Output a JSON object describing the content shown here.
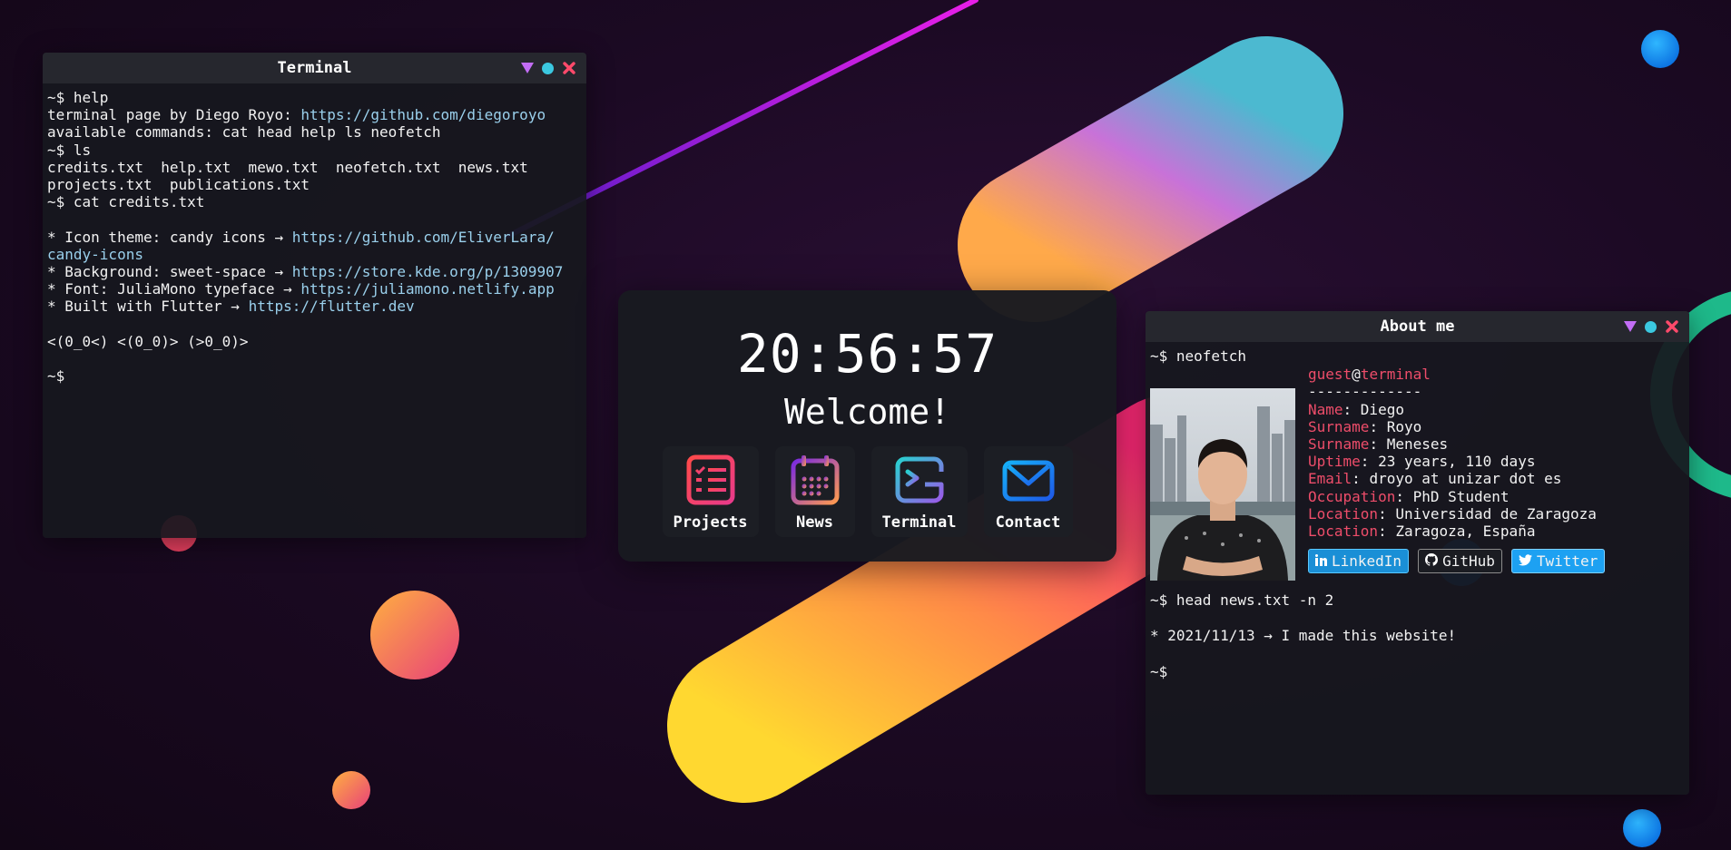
{
  "terminal": {
    "title": "Terminal",
    "lines": [
      [
        {
          "t": "~$ help"
        }
      ],
      [
        {
          "t": "terminal page by Diego Royo: "
        },
        {
          "t": "https://github.com/diegoroyo",
          "c": "link"
        }
      ],
      [
        {
          "t": "available commands: cat head help ls neofetch"
        }
      ],
      [
        {
          "t": "~$ ls"
        }
      ],
      [
        {
          "t": "credits.txt  help.txt  mewo.txt  neofetch.txt  news.txt"
        }
      ],
      [
        {
          "t": "projects.txt  publications.txt"
        }
      ],
      [
        {
          "t": "~$ cat credits.txt"
        }
      ],
      [
        {
          "t": ""
        }
      ],
      [
        {
          "t": "* Icon theme: candy icons → "
        },
        {
          "t": "https://github.com/EliverLara/",
          "c": "link"
        }
      ],
      [
        {
          "t": "candy-icons",
          "c": "link"
        }
      ],
      [
        {
          "t": "* Background: sweet-space → "
        },
        {
          "t": "https://store.kde.org/p/1309907",
          "c": "link"
        }
      ],
      [
        {
          "t": "* Font: JuliaMono typeface → "
        },
        {
          "t": "https://juliamono.netlify.app",
          "c": "link"
        }
      ],
      [
        {
          "t": "* Built with Flutter → "
        },
        {
          "t": "https://flutter.dev",
          "c": "link"
        }
      ],
      [
        {
          "t": ""
        }
      ],
      [
        {
          "t": "<(0_0<) <(0_0)> (>0_0)>"
        }
      ],
      [
        {
          "t": ""
        }
      ],
      [
        {
          "t": "~$"
        }
      ]
    ]
  },
  "launcher": {
    "clock": "20:56:57",
    "welcome": "Welcome!",
    "apps": [
      {
        "label": "Projects",
        "icon": "projects-icon"
      },
      {
        "label": "News",
        "icon": "calendar-icon"
      },
      {
        "label": "Terminal",
        "icon": "terminal-icon"
      },
      {
        "label": "Contact",
        "icon": "mail-icon"
      }
    ]
  },
  "about": {
    "title": "About me",
    "command": "~$ neofetch",
    "user": "guest",
    "at": "@",
    "host": "terminal",
    "separator": "-------------",
    "fields": [
      {
        "key": "Name",
        "value": "Diego"
      },
      {
        "key": "Surname",
        "value": "Royo"
      },
      {
        "key": "Surname",
        "value": "Meneses"
      },
      {
        "key": "Uptime",
        "value": "23 years, 110 days"
      },
      {
        "key": "Email",
        "value": "droyo at unizar dot es"
      },
      {
        "key": "Occupation",
        "value": "PhD Student"
      },
      {
        "key": "Location",
        "value": "Universidad de Zaragoza"
      },
      {
        "key": "Location",
        "value": "Zaragoza, España"
      }
    ],
    "socials": [
      {
        "label": "LinkedIn",
        "icon": "linkedin-icon",
        "color": "#1a8fd6",
        "border": "#5ac8ff"
      },
      {
        "label": "GitHub",
        "icon": "github-icon",
        "color": "#1b1c22",
        "border": "#8c8c8c"
      },
      {
        "label": "Twitter",
        "icon": "twitter-icon",
        "color": "#1da1f2",
        "border": "#7fd1ff"
      }
    ],
    "head_command": "~$ head news.txt -n 2",
    "news": "* 2021/11/13 → I made this website!",
    "final_prompt": "~$"
  },
  "colors": {
    "key": "#ee4d6a",
    "link": "#9ad0ec",
    "close": "#ff4a6b",
    "minimize": "#c26df5",
    "maximize": "#3bc8e0"
  }
}
